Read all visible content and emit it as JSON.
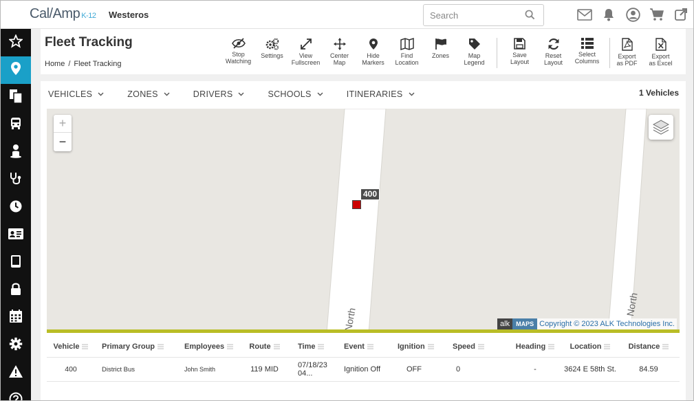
{
  "app": {
    "logo": "Cal/Amp",
    "logo_suffix": "K-12",
    "org_name": "Westeros",
    "search_placeholder": "Search",
    "accent_color": "#1aa0c8"
  },
  "top_icons": [
    "mail-icon",
    "bell-icon",
    "user-icon",
    "cart-icon",
    "external-link-icon"
  ],
  "sidebar": {
    "items": [
      {
        "name": "favorites",
        "icon": "star-icon"
      },
      {
        "name": "tracking",
        "icon": "map-pin-icon",
        "active": true
      },
      {
        "name": "documents",
        "icon": "documents-icon"
      },
      {
        "name": "bus",
        "icon": "bus-icon"
      },
      {
        "name": "students",
        "icon": "student-icon"
      },
      {
        "name": "health",
        "icon": "stethoscope-icon"
      },
      {
        "name": "time",
        "icon": "clock-icon"
      },
      {
        "name": "id-cards",
        "icon": "id-card-icon"
      },
      {
        "name": "tablet",
        "icon": "tablet-icon"
      },
      {
        "name": "security",
        "icon": "lock-icon"
      },
      {
        "name": "calendar",
        "icon": "calendar-icon"
      },
      {
        "name": "settings",
        "icon": "gear-icon"
      },
      {
        "name": "alerts",
        "icon": "warning-icon"
      },
      {
        "name": "help",
        "icon": "help-icon"
      }
    ]
  },
  "page": {
    "title": "Fleet Tracking",
    "breadcrumb": [
      "Home",
      "Fleet Tracking"
    ]
  },
  "toolbar": {
    "groups": [
      [
        {
          "label1": "Stop",
          "label2": "Watching",
          "icon": "eye-slash-icon"
        },
        {
          "label1": "Settings",
          "label2": "",
          "icon": "gears-icon"
        },
        {
          "label1": "View",
          "label2": "Fullscreen",
          "icon": "expand-icon"
        },
        {
          "label1": "Center",
          "label2": "Map",
          "icon": "move-icon"
        },
        {
          "label1": "Hide",
          "label2": "Markers",
          "icon": "marker-icon"
        },
        {
          "label1": "Find",
          "label2": "Location",
          "icon": "map-icon"
        },
        {
          "label1": "Zones",
          "label2": "",
          "icon": "flag-icon"
        },
        {
          "label1": "Map",
          "label2": "Legend",
          "icon": "tag-icon"
        }
      ],
      [
        {
          "label1": "Save",
          "label2": "Layout",
          "icon": "save-icon"
        },
        {
          "label1": "Reset",
          "label2": "Layout",
          "icon": "refresh-icon"
        },
        {
          "label1": "Select",
          "label2": "Columns",
          "icon": "list-icon"
        }
      ],
      [
        {
          "label1": "Export",
          "label2": "as PDF",
          "icon": "pdf-icon"
        },
        {
          "label1": "Export",
          "label2": "as Excel",
          "icon": "excel-icon"
        }
      ]
    ]
  },
  "filters": [
    "VEHICLES",
    "ZONES",
    "DRIVERS",
    "SCHOOLS",
    "ITINERARIES"
  ],
  "vehicle_count": "1 Vehicles",
  "map": {
    "marker_label": "400",
    "street_labels": [
      "North",
      "North"
    ],
    "attribution_alk": "alk",
    "attribution_maps": "MAPS",
    "copyright": "Copyright © 2023 ALK Technologies Inc.",
    "zoom_in": "+",
    "zoom_out": "−"
  },
  "table": {
    "columns": [
      "Vehicle",
      "Primary Group",
      "Employees",
      "Route",
      "Time",
      "Event",
      "Ignition",
      "Speed",
      "Heading",
      "Location",
      "Distance"
    ],
    "rows": [
      [
        "400",
        "District Bus",
        "John Smith",
        "119 MID",
        "07/18/23 04...",
        "Ignition Off",
        "OFF",
        "0",
        "-",
        "3624 E 58th St.",
        "84.59"
      ]
    ]
  }
}
